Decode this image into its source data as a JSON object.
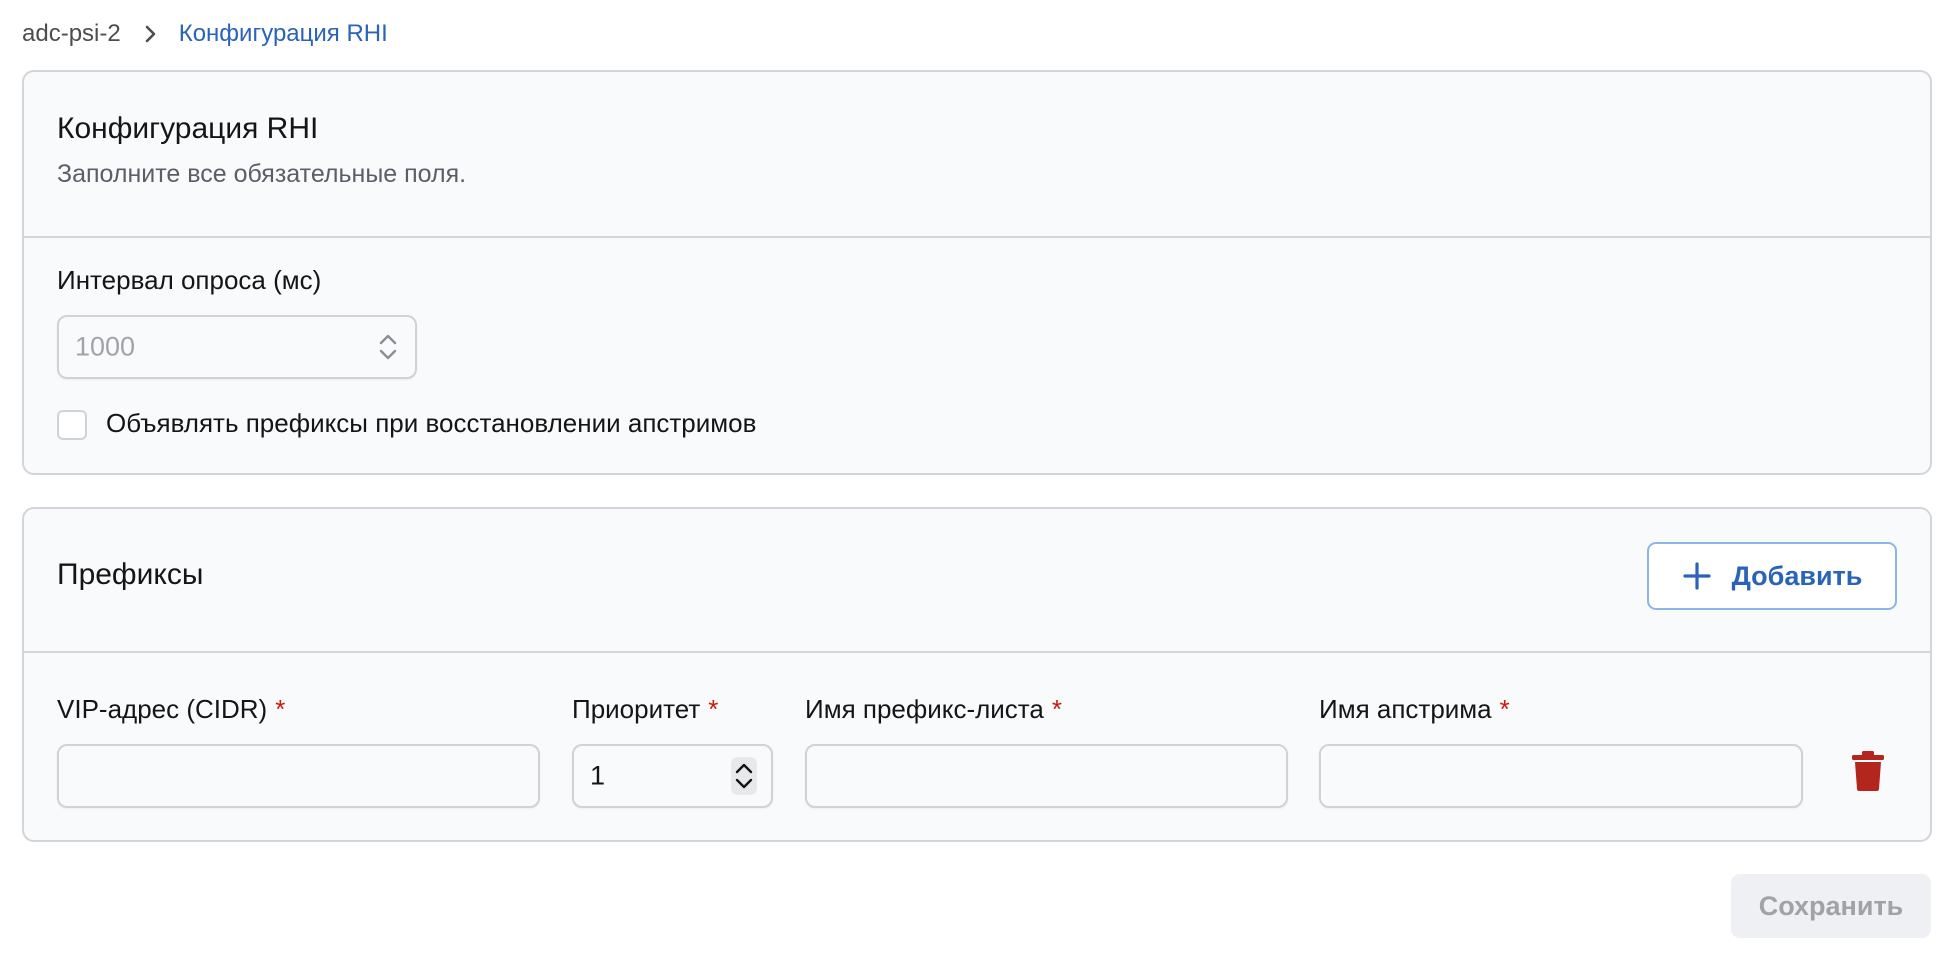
{
  "breadcrumb": {
    "root": "adc-psi-2",
    "current": "Конфигурация RHI"
  },
  "config_card": {
    "title": "Конфигурация RHI",
    "subtitle": "Заполните все обязательные поля.",
    "interval": {
      "label": "Интервал опроса (мс)",
      "placeholder": "1000",
      "value": ""
    },
    "announce_checkbox": {
      "label": "Объявлять префиксы при восстановлении апстримов",
      "checked": false
    }
  },
  "prefixes_card": {
    "title": "Префиксы",
    "add_button": "Добавить",
    "required_mark": "*",
    "columns": {
      "vip": "VIP-адрес (CIDR)",
      "priority": "Приоритет",
      "prefix_list": "Имя префикс-листа",
      "upstream": "Имя апстрима"
    },
    "row": {
      "vip": "",
      "priority": "1",
      "prefix_list": "",
      "upstream": ""
    }
  },
  "footer": {
    "save_button": "Сохранить"
  },
  "colors": {
    "accent": "#2a64b8",
    "danger": "#c9190b",
    "card_bg": "#f9fafc",
    "border": "#d2d5da",
    "disabled_text": "#9fa3a8"
  },
  "icons": {
    "breadcrumb_separator": "chevron-right-icon",
    "add": "plus-icon",
    "delete": "trash-icon",
    "spinner": "chevron-up-down-icon"
  }
}
